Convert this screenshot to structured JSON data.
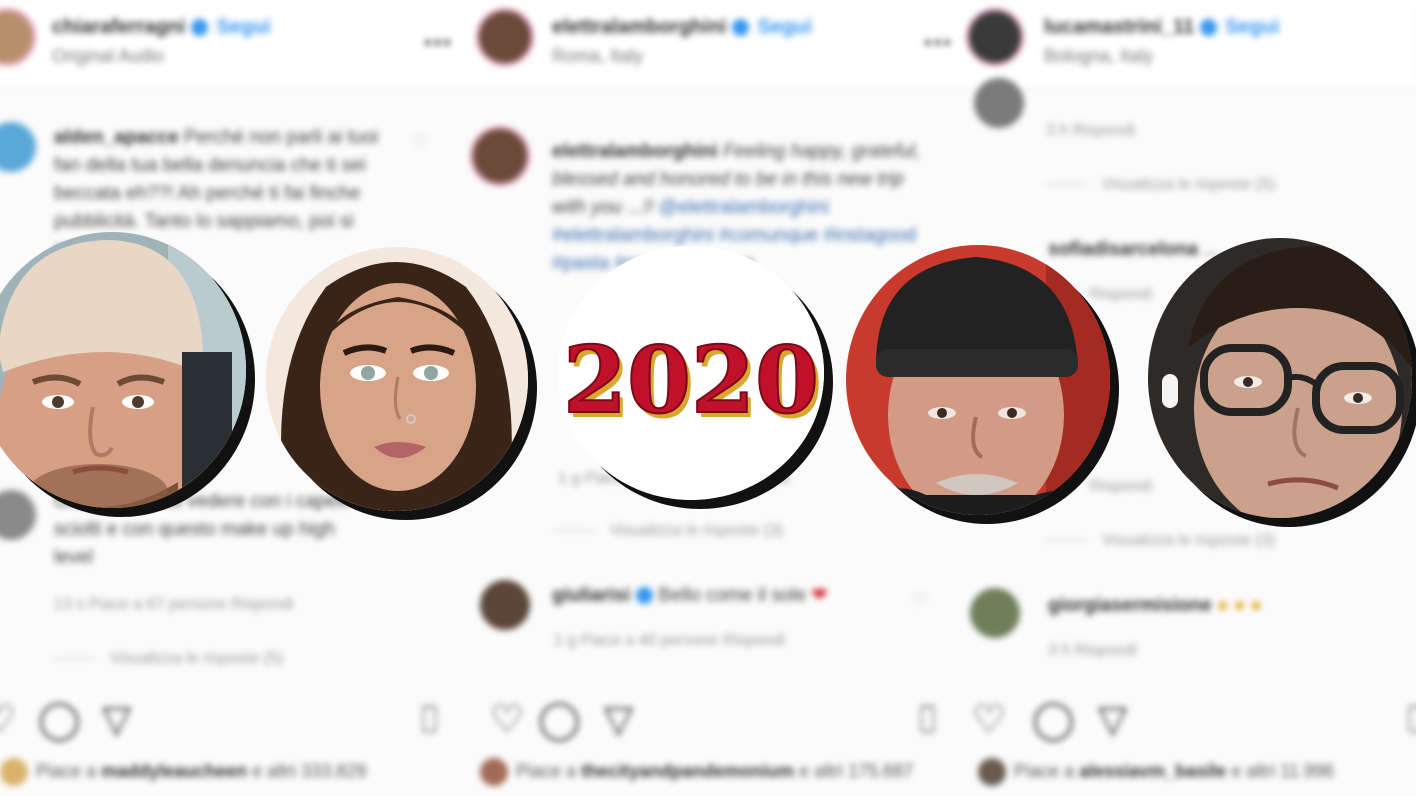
{
  "columns": [
    {
      "header": {
        "username": "chiaraferragni",
        "follow": "Segui",
        "subtitle": "Original Audio",
        "more": "•••"
      },
      "comments": [
        {
          "user": "alden_apacce",
          "text": "Perché non parli ai tuoi fan della tua bella denuncia che ti sei beccata eh??! Ah perché ti fai finche pubblicità. Tanto lo sappiamo, poi si scoprirà.",
          "meta": "",
          "replies": ""
        },
        {
          "user": "",
          "text": "Ora ti vogliamo vedere con i capelli sciolti e con questo make up high level",
          "meta": "13 s   Piace a 67 persone   Rispondi",
          "replies": "Visualizza le risposte (5)"
        }
      ],
      "likes": {
        "prefix": "Piace a",
        "user": "maddyleaucheen",
        "suffix": "e altri 333.829"
      }
    },
    {
      "header": {
        "username": "elettralamborghini",
        "follow": "Segui",
        "subtitle": "Roma, Italy",
        "more": "•••"
      },
      "comments": [
        {
          "user": "elettralamborghini",
          "text": "Feeling happy, grateful, blessed and honored to be in this new trip with you ...!!",
          "tags": "@elettralamborghini #elettralamborghini #comunque #instagood #pasta #gorgeous #love",
          "meta": "",
          "replies": ""
        },
        {
          "user": "",
          "text": "",
          "meta": "1 g   Piace a 44 persone   Rispondi",
          "replies": "Visualizza le risposte (3)"
        },
        {
          "user": "giuliarisi",
          "text": "Bello come il sole",
          "meta": "1 g   Piace a 40 persone   Rispondi",
          "replies": ""
        }
      ],
      "likes": {
        "prefix": "Piace a",
        "user": "thecityandpandemonium",
        "suffix": "e altri 175.687"
      }
    },
    {
      "header": {
        "username": "lucamastrini_11",
        "follow": "Segui",
        "subtitle": "Bologna, Italy",
        "more": "•••"
      },
      "comments": [
        {
          "user": "",
          "text": "",
          "meta": "3 h   Rispondi",
          "replies": "Visualizza le risposte (5)"
        },
        {
          "user": "sofiadisarcelona",
          "text": "...",
          "meta": "Rispondi",
          "replies": ""
        },
        {
          "user": "",
          "text": "",
          "meta": "Rispondi",
          "replies": "Visualizza le risposte (3)"
        },
        {
          "user": "giorgiasermisione",
          "text": "",
          "meta": "3 h   Rispondi",
          "replies": ""
        }
      ],
      "likes": {
        "prefix": "Piace a",
        "user": "alessiavm_basile",
        "suffix": "e altri 11.996"
      }
    }
  ],
  "year_badge": {
    "text": "2020",
    "color": "#c0102a",
    "edge": "#d9a72c"
  },
  "portraits": [
    {
      "name": "man-white-cap"
    },
    {
      "name": "woman-long-hair"
    },
    {
      "name": "year-2020"
    },
    {
      "name": "man-black-beanie"
    },
    {
      "name": "man-glasses-earbud"
    }
  ],
  "icons": {
    "verified": "blue-check",
    "bookmark": "bookmark-icon",
    "heart": "heart-icon",
    "comment": "comment-bubble-icon",
    "share": "send-icon"
  }
}
